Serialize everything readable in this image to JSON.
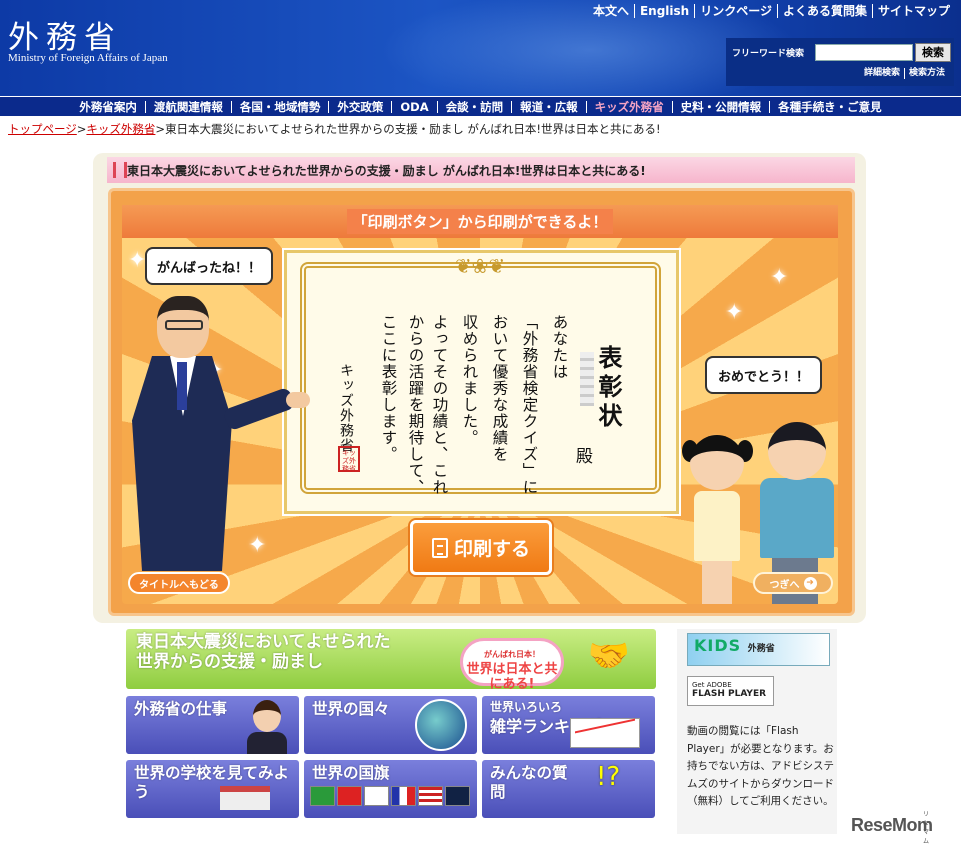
{
  "header": {
    "logo_jp": "外務省",
    "logo_en": "Ministry of Foreign Affairs of Japan",
    "utility_links": [
      "本文へ",
      "English",
      "リンクページ",
      "よくある質問集",
      "サイトマップ"
    ],
    "search": {
      "label": "フリーワード検索",
      "placeholder": "",
      "button": "検索",
      "links": [
        "詳細検索",
        "検索方法"
      ]
    }
  },
  "nav": {
    "items": [
      "外務省案内",
      "渡航関連情報",
      "各国・地域情勢",
      "外交政策",
      "ODA",
      "会談・訪問",
      "報道・広報",
      "キッズ外務省",
      "史料・公開情報",
      "各種手続き・ご意見"
    ],
    "active": "キッズ外務省"
  },
  "breadcrumb": {
    "home": "トップページ",
    "kids": "キッズ外務省",
    "sep": ">",
    "current": "東日本大震災においてよせられた世界からの支援・励まし がんばれ日本!世界は日本と共にある!"
  },
  "panel": {
    "title": "東日本大震災においてよせられた世界からの支援・励まし がんばれ日本!世界は日本と共にある!",
    "print_banner": "「印刷ボタン」から印刷ができるよ！",
    "bubble_left": "がんばったね！！",
    "bubble_right": "おめでとう！！",
    "print_button": "印刷する",
    "back_button": "タイトルへもどる",
    "next_button": "つぎへ"
  },
  "certificate": {
    "ornament": "❦❀❦",
    "title": "表彰状",
    "honorific": "殿",
    "lines": [
      "あなたは",
      "「外務省検定クイズ」に",
      "おいて優秀な成績を",
      "収められました。",
      "よってその功績と、これ",
      "からの活躍を期待して、",
      "ここに表彰します。"
    ],
    "issuer": "キッズ外務省",
    "seal": "キッズ外務省"
  },
  "banners": {
    "support_line1": "東日本大震災においてよせられた",
    "support_line2": "世界からの支援・励まし",
    "badge_small": "がんばれ日本！",
    "badge_main": "世界は日本と共にある!",
    "tiles": {
      "work": "外務省の仕事",
      "countries": "世界の国々",
      "ranking_small": "世界いろいろ",
      "ranking_big": "雑学ランキング",
      "schools": "世界の学校を見てみよう",
      "flags": "世界の国旗",
      "questions": "みんなの質問"
    }
  },
  "sidebar": {
    "kids_logo": "KIDS",
    "kids_sub": "外務省",
    "flash_get": "Get ADOBE",
    "flash_player": "FLASH PLAYER",
    "note": "動画の閲覧には「Flash Player」が必要となります。お持ちでない方は、アドビシステムズのサイトからダウンロード（無料）してご利用ください。"
  },
  "watermark": {
    "brand": "ReseMom",
    "sub": "リセマム"
  },
  "colors": {
    "header_blue": "#1346b4",
    "nav_blue": "#0b2a8c",
    "stage_orange": "#f3a24a",
    "title_pink": "#f6b5cc",
    "support_green": "#8fcd40",
    "tile_blue": "#5a5fc8"
  }
}
